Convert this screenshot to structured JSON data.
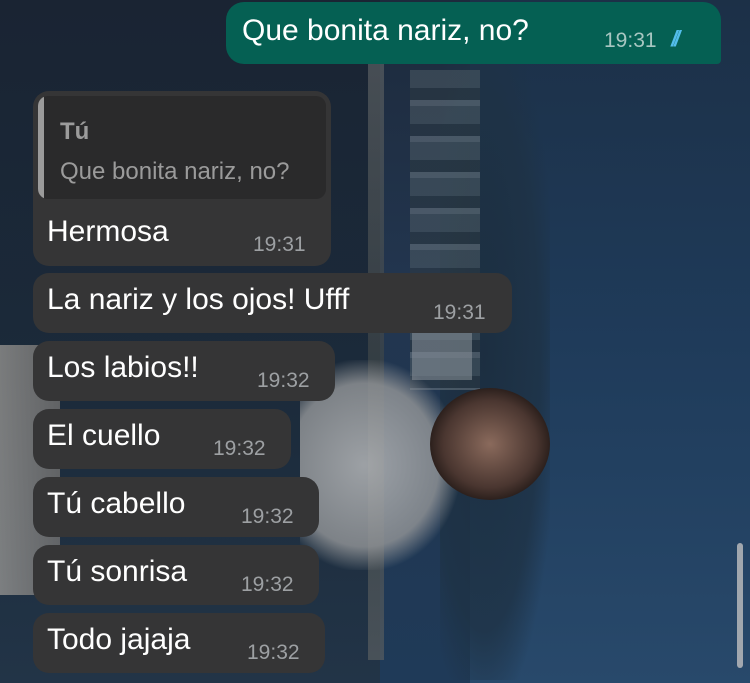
{
  "chat": {
    "outgoing": {
      "text": "Que bonita nariz, no?",
      "time": "19:31",
      "status_icon": "double-check-read-icon"
    },
    "reply": {
      "quote_author": "Tú",
      "quote_text": "Que bonita nariz, no?",
      "text": "Hermosa",
      "time": "19:31"
    },
    "incoming": [
      {
        "text": "La nariz y los ojos! Ufff",
        "time": "19:31"
      },
      {
        "text": "Los labios!!",
        "time": "19:32"
      },
      {
        "text": "El cuello",
        "time": "19:32"
      },
      {
        "text": "Tú cabello",
        "time": "19:32"
      },
      {
        "text": "Tú sonrisa",
        "time": "19:32"
      },
      {
        "text": "Todo jajaja",
        "time": "19:32"
      }
    ]
  },
  "colors": {
    "outgoing_bubble": "#056053",
    "incoming_bubble": "#353536",
    "read_check": "#53bdeb"
  }
}
